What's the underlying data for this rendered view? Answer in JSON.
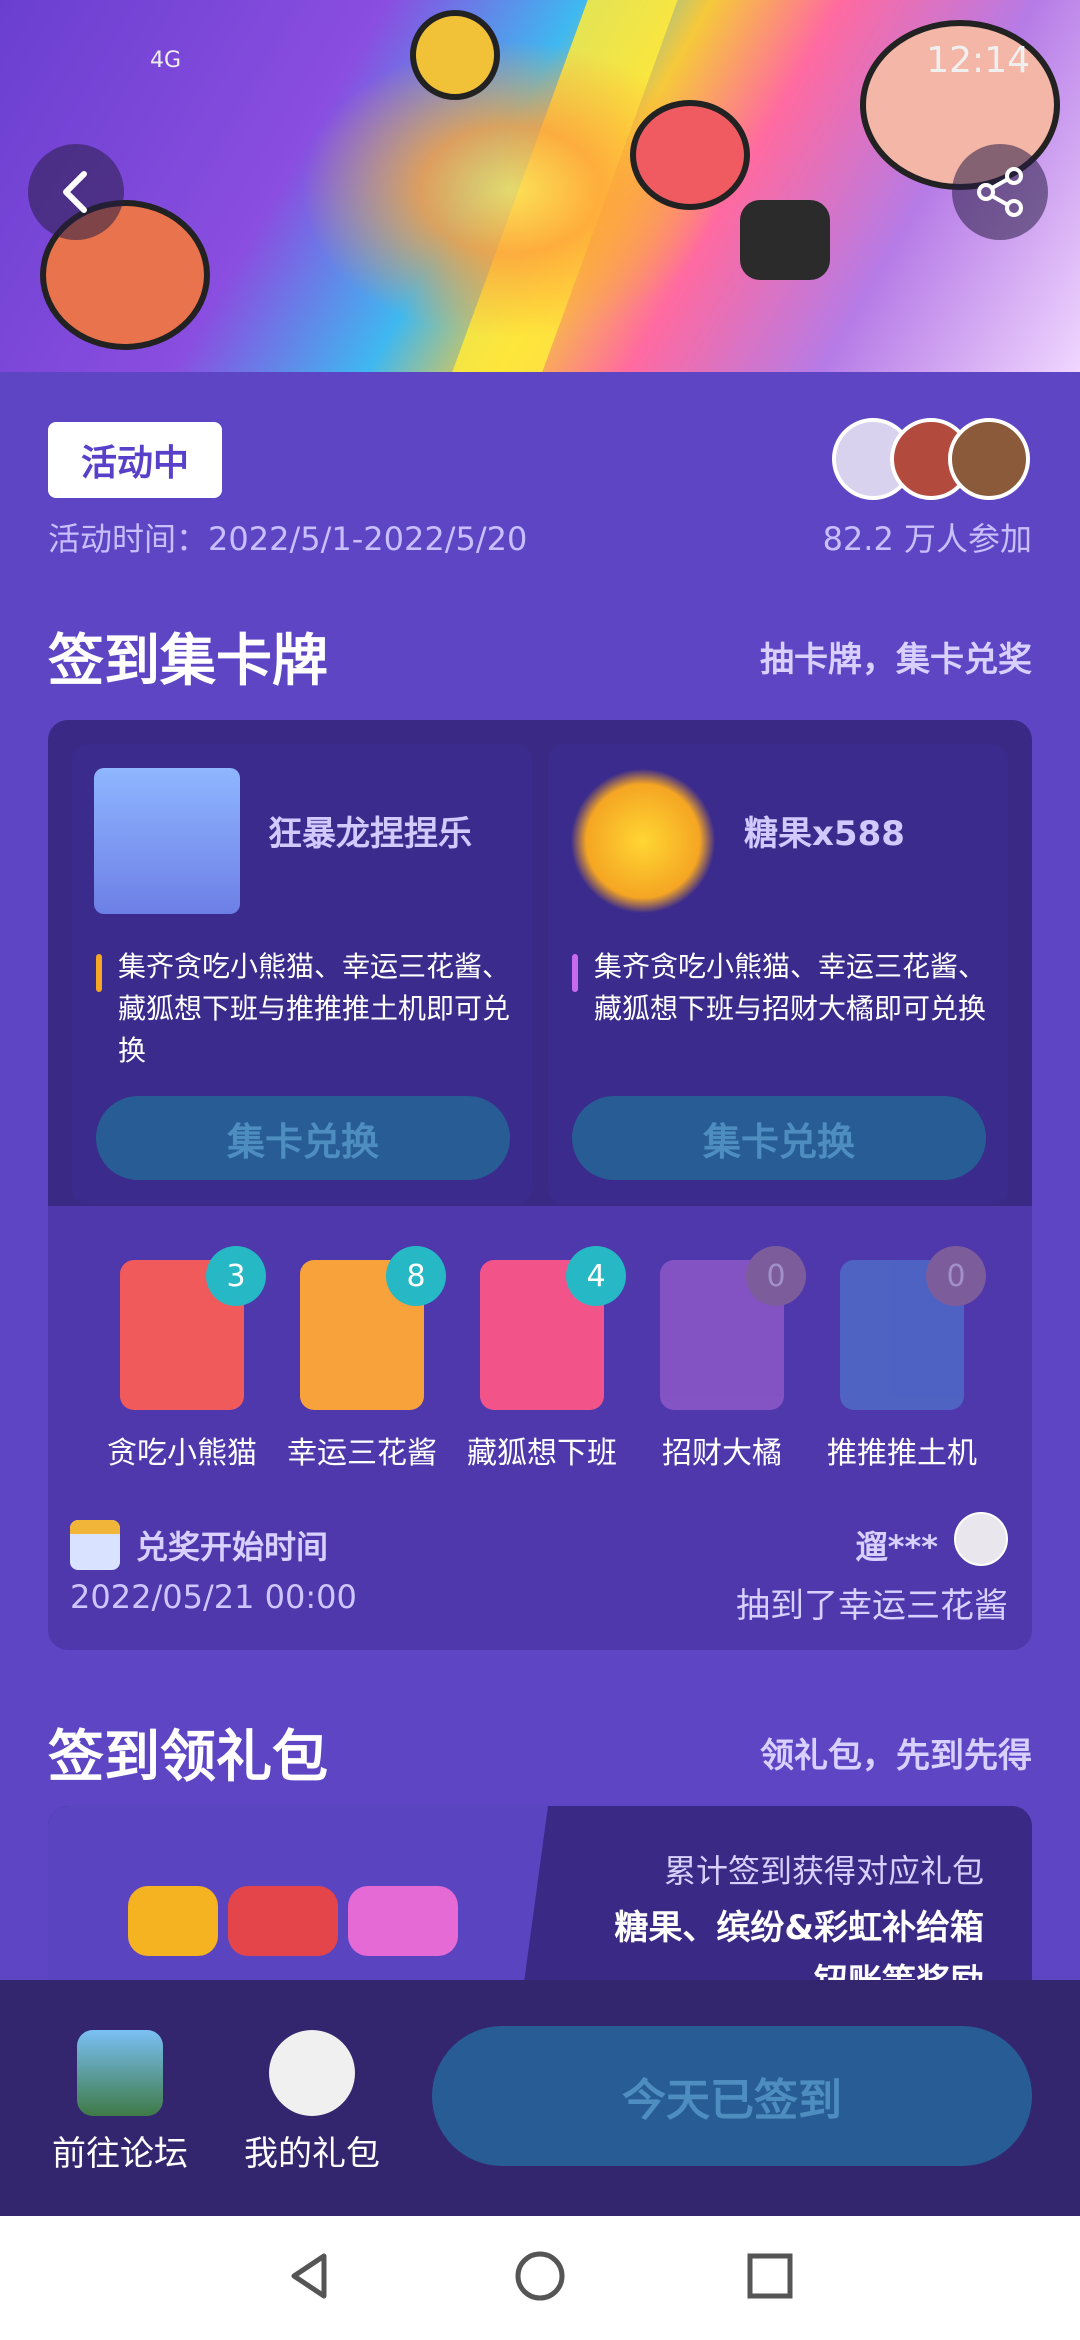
{
  "status": {
    "network": "4G",
    "time": "12:14"
  },
  "activity": {
    "badge": "活动中",
    "time_text": "活动时间：2022/5/1-2022/5/20",
    "participants": "82.2 万人参加"
  },
  "section1": {
    "title": "签到集卡牌",
    "subtitle": "抽卡牌，集卡兑奖",
    "rewards": [
      {
        "title": "狂暴龙捏捏乐",
        "desc": "集齐贪吃小熊猫、幸运三花酱、藏狐想下班与推推推土机即可兑换",
        "button": "集卡兑换",
        "accent": "#f5a623"
      },
      {
        "title": "糖果x588",
        "desc": "集齐贪吃小熊猫、幸运三花酱、藏狐想下班与招财大橘即可兑换",
        "button": "集卡兑换",
        "accent": "#c86af0"
      }
    ],
    "cards": [
      {
        "label": "贪吃小熊猫",
        "count": "3",
        "color": "#f05a5a"
      },
      {
        "label": "幸运三花酱",
        "count": "8",
        "color": "#f7a23a"
      },
      {
        "label": "藏狐想下班",
        "count": "4",
        "color": "#f2548a"
      },
      {
        "label": "招财大橘",
        "count": "0",
        "color": "#b06ad8"
      },
      {
        "label": "推推推土机",
        "count": "0",
        "color": "#4f86d6"
      }
    ],
    "redeem_label": "兑奖开始时间",
    "redeem_time": "2022/05/21 00:00",
    "winner_name": "遛***",
    "winner_msg": "抽到了幸运三花酱"
  },
  "section2": {
    "title": "签到领礼包",
    "subtitle": "领礼包，先到先得",
    "line1": "累计签到获得对应礼包",
    "line2": "糖果、缤纷&彩虹补给箱",
    "line3": "钮账等奖励"
  },
  "bottom": {
    "forum": "前往论坛",
    "gifts": "我的礼包",
    "signed": "今天已签到"
  }
}
